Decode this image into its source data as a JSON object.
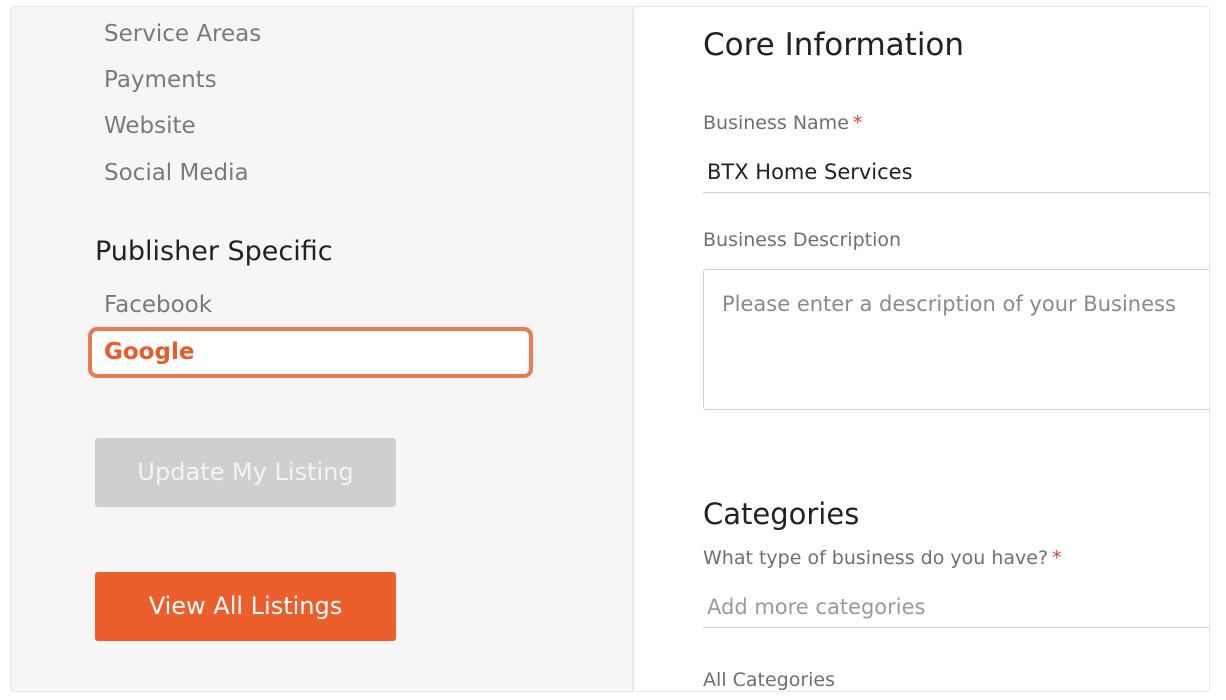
{
  "sidebar": {
    "nav_items": [
      "Service Areas",
      "Payments",
      "Website",
      "Social Media"
    ],
    "section_heading": "Publisher Specific",
    "publisher_items": [
      "Facebook",
      "Google"
    ],
    "active_item": "Google",
    "update_button": "Update My Listing",
    "view_all_button": "View All Listings"
  },
  "main": {
    "section_title": "Core Information",
    "business_name_label": "Business Name",
    "required_marker": "*",
    "business_name_value": "BTX Home Services",
    "business_description_label": "Business Description",
    "business_description_placeholder": "Please enter a description of your Business",
    "categories_title": "Categories",
    "categories_question": "What type of business do you have?",
    "categories_placeholder": "Add more categories",
    "all_categories_label": "All Categories"
  },
  "colors": {
    "accent": "#ec5e2c",
    "highlight_border": "#ea7b4f",
    "disabled_button": "#cfcfcf",
    "required": "#d8442e"
  }
}
